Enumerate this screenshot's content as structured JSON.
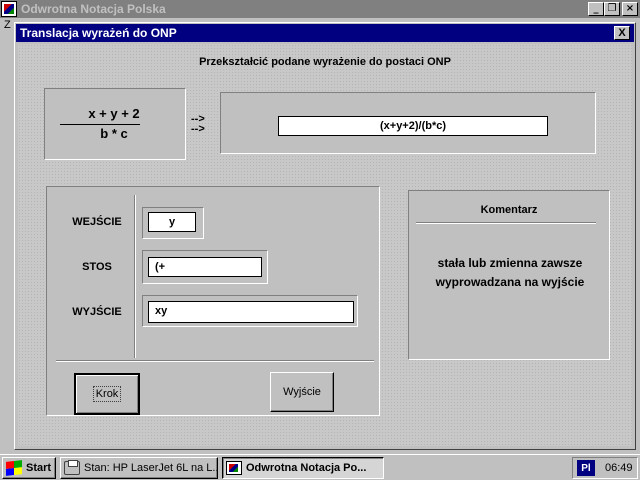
{
  "window": {
    "title": "Odwrotna Notacja Polska",
    "menu_label": "Z"
  },
  "dialog": {
    "title": "Translacja wyrażeń do ONP",
    "close_glyph": "X",
    "instruction": "Przekształcić podane wyrażenie do postaci ONP",
    "expression": {
      "numerator": "x + y + 2",
      "denominator": "b * c"
    },
    "arrow": "-->",
    "result": "(x+y+2)/(b*c)",
    "rows": {
      "input_label": "WEJŚCIE",
      "input_value": "y",
      "stack_label": "STOS",
      "stack_value": "(+",
      "output_label": "WYJŚCIE",
      "output_value": "xy"
    },
    "buttons": {
      "step": "Krok",
      "exit": "Wyjście"
    },
    "comment": {
      "title": "Komentarz",
      "line1": "stała lub zmienna zawsze",
      "line2": "wyprowadzana na wyjście"
    }
  },
  "taskbar": {
    "start": "Start",
    "tasks": [
      {
        "label": "Stan: HP LaserJet 6L na L..."
      },
      {
        "label": "Odwrotna Notacja Po..."
      }
    ],
    "tray_indicator": "Pl",
    "clock": "06:49"
  }
}
